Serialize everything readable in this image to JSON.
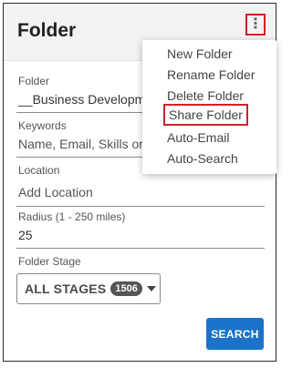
{
  "header": {
    "title": "Folder",
    "menu_icon": "vertical-ellipsis-icon"
  },
  "form": {
    "folder": {
      "label": "Folder",
      "value": "__Business Development"
    },
    "keywords": {
      "label": "Keywords",
      "placeholder": "Name, Email, Skills or C"
    },
    "location": {
      "label": "Location",
      "placeholder": "Add Location"
    },
    "radius": {
      "label": "Radius (1 - 250 miles)",
      "value": "25"
    },
    "stage": {
      "label": "Folder Stage",
      "selected": "ALL STAGES",
      "count": "1506",
      "caret_icon": "caret-down-icon"
    },
    "search_label": "SEARCH"
  },
  "menu": {
    "items": [
      {
        "label": "New Folder"
      },
      {
        "label": "Rename Folder"
      },
      {
        "label": "Delete Folder"
      },
      {
        "label": "Share Folder",
        "highlighted": true
      },
      {
        "label": "Auto-Email"
      },
      {
        "label": "Auto-Search"
      }
    ]
  },
  "colors": {
    "accent": "#1a73c8",
    "highlight_border": "#d0202a",
    "header_bg": "#f2f2f2"
  }
}
